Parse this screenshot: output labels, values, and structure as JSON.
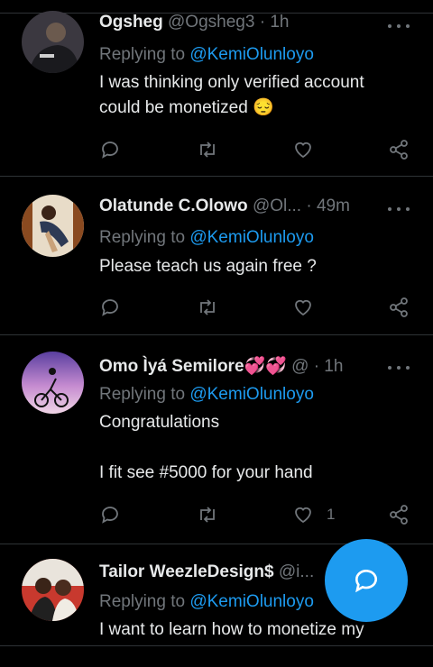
{
  "tweets": [
    {
      "name": "Ogsheg",
      "handle": "@Ogsheg3",
      "time": "1h",
      "replying_prefix": "Replying to",
      "replying_to": "@KemiOlunloyo",
      "lines": [
        "I was thinking only verified account",
        "could be monetized 😔"
      ],
      "like_count": ""
    },
    {
      "name": "Olatunde C.Olowo",
      "handle": "@Ol...",
      "time": "49m",
      "replying_prefix": "Replying to",
      "replying_to": "@KemiOlunloyo",
      "lines": [
        "Please teach us again free ?"
      ],
      "like_count": ""
    },
    {
      "name": "Omo Ìyá Semilore💞💞",
      "handle": "@",
      "time": "1h",
      "replying_prefix": "Replying to",
      "replying_to": "@KemiOlunloyo",
      "lines": [
        "Congratulations",
        "",
        "I fit see #5000 for your hand"
      ],
      "like_count": "1"
    },
    {
      "name": "Tailor WeezleDesign$",
      "handle": "@i...",
      "time": "",
      "replying_prefix": "Replying to",
      "replying_to": "@KemiOlunloyo",
      "lines": [
        "I want to learn how to monetize my"
      ],
      "like_count": ""
    }
  ],
  "separator": "·",
  "icons": {
    "reply": "reply-icon",
    "retweet": "retweet-icon",
    "like": "heart-icon",
    "share": "share-icon",
    "more": "more-icon",
    "compose": "compose-reply-icon"
  },
  "colors": {
    "accent": "#1d9bf0",
    "muted": "#71767b",
    "text": "#e7e9ea",
    "background": "#000000"
  }
}
